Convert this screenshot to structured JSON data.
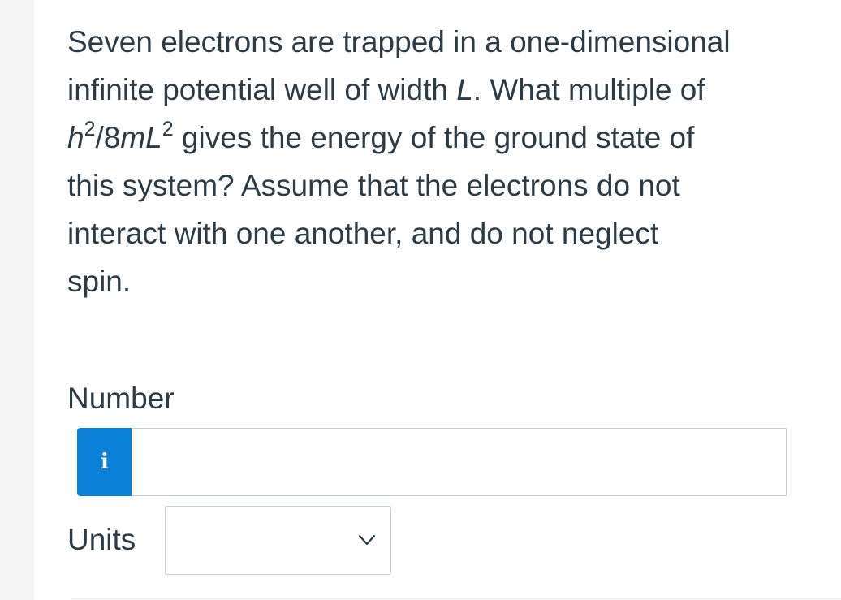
{
  "question": {
    "line1": "Seven electrons are trapped in a one-dimensional",
    "line2_prefix": "infinite potential well of width ",
    "line2_var": "L",
    "line2_suffix": ". What multiple of",
    "line3_h": "h",
    "line3_exp1": "2",
    "line3_mid": "/8",
    "line3_mL": "mL",
    "line3_exp2": "2",
    "line3_suffix": " gives the energy of the ground state of",
    "line4": "this system? Assume that the electrons do not",
    "line5": "interact with one another, and do not neglect",
    "line6": "spin."
  },
  "number_field": {
    "label": "Number",
    "info_glyph": "i",
    "value": ""
  },
  "units_field": {
    "label": "Units",
    "selected": ""
  },
  "colors": {
    "text": "#2d3b45",
    "info_button": "#0b80d8",
    "border": "#c7cdd1",
    "gutter": "#f5f5f5"
  },
  "icons": {
    "info": "info-icon",
    "dropdown": "chevron-down-icon"
  }
}
